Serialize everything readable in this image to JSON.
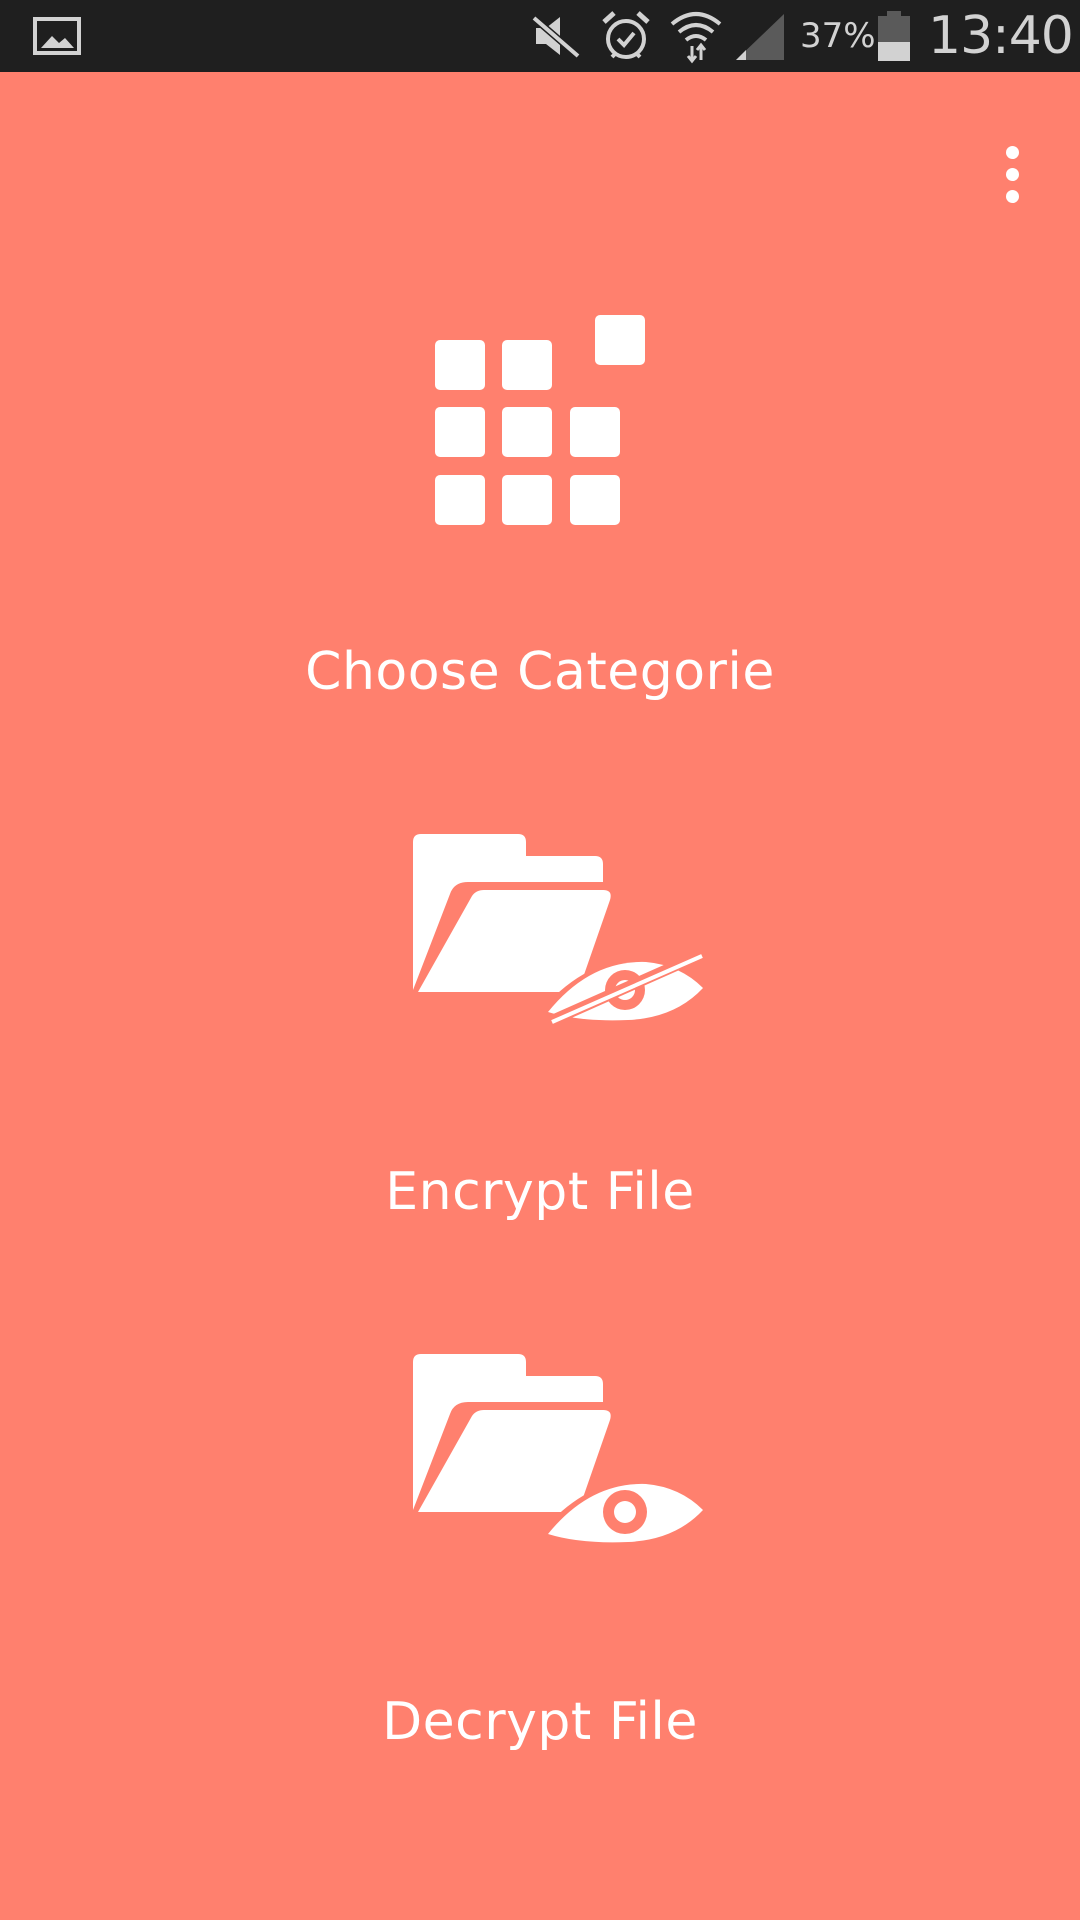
{
  "status_bar": {
    "battery_percent": "37%",
    "time": "13:40",
    "icons": [
      "gallery-notification-icon",
      "mute-icon",
      "alarm-icon",
      "wifi-icon",
      "signal-icon",
      "battery-icon"
    ]
  },
  "app": {
    "background_color": "#ff806e",
    "foreground_color": "#ffffff",
    "menu_icon": "more-vert-icon",
    "actions": [
      {
        "label": "Choose Categorie",
        "icon": "category-grid-icon"
      },
      {
        "label": "Encrypt File",
        "icon": "folder-hidden-eye-icon"
      },
      {
        "label": "Decrypt File",
        "icon": "folder-eye-icon"
      }
    ]
  }
}
